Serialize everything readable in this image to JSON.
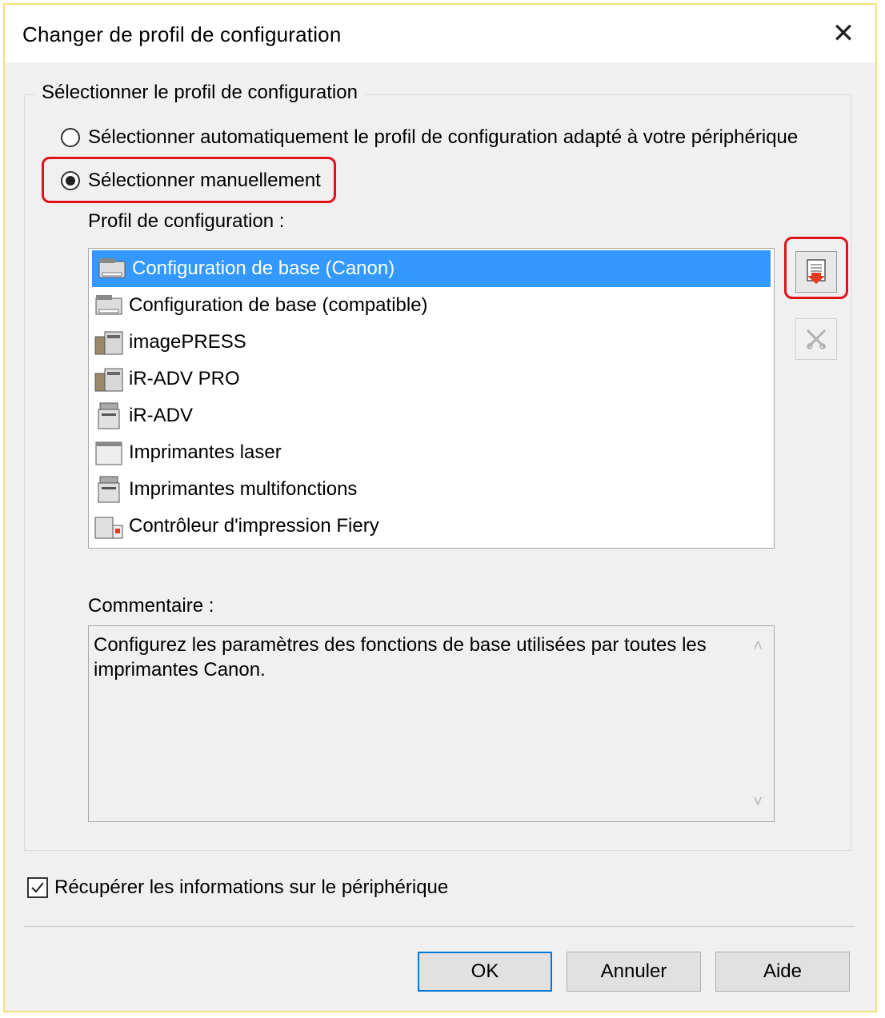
{
  "dialog": {
    "title": "Changer de profil de configuration",
    "close_label": "✕"
  },
  "group": {
    "legend": "Sélectionner le profil de configuration",
    "radio_auto_label": "Sélectionner automatiquement le profil de configuration adapté à votre périphérique",
    "radio_manual_label": "Sélectionner manuellement",
    "selected_mode": "manual"
  },
  "profiles": {
    "label": "Profil de configuration :",
    "items": [
      {
        "label": "Configuration de base (Canon)",
        "icon": "basic-config-icon",
        "selected": true
      },
      {
        "label": "Configuration de base (compatible)",
        "icon": "basic-config-icon",
        "selected": false
      },
      {
        "label": "imagePRESS",
        "icon": "production-printer-icon",
        "selected": false
      },
      {
        "label": "iR-ADV PRO",
        "icon": "production-printer-icon",
        "selected": false
      },
      {
        "label": "iR-ADV",
        "icon": "multifunction-printer-icon",
        "selected": false
      },
      {
        "label": "Imprimantes laser",
        "icon": "laser-printer-icon",
        "selected": false
      },
      {
        "label": "Imprimantes multifonctions",
        "icon": "multifunction-printer-icon",
        "selected": false
      },
      {
        "label": "Contrôleur d'impression Fiery",
        "icon": "fiery-controller-icon",
        "selected": false
      }
    ]
  },
  "comment": {
    "label": "Commentaire :",
    "text": "Configurez les paramètres des fonctions de base utilisées par toutes les imprimantes Canon."
  },
  "retrieve_info": {
    "label": "Récupérer les informations sur le périphérique",
    "checked": true
  },
  "buttons": {
    "ok": "OK",
    "cancel": "Annuler",
    "help": "Aide"
  },
  "colors": {
    "highlight": "#e1121a",
    "selection": "#3399ff",
    "import_arrow": "#e53a1e"
  }
}
